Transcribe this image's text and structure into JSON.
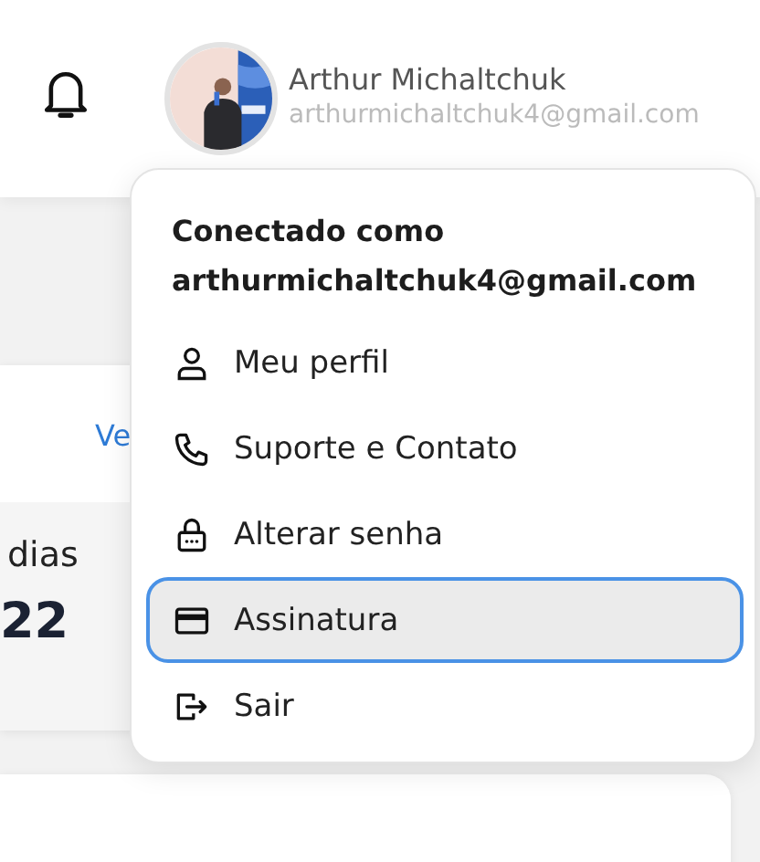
{
  "header": {
    "user": {
      "name": "Arthur Michaltchuk",
      "email": "arthurmichaltchuk4@gmail.com"
    }
  },
  "background_card": {
    "link": "Ve",
    "label": "dias",
    "value": "22"
  },
  "menu": {
    "title": "Conectado como",
    "email": "arthurmichaltchuk4@gmail.com",
    "items": [
      {
        "label": "Meu perfil",
        "kind": "profile",
        "selected": false
      },
      {
        "label": "Suporte e Contato",
        "kind": "phone",
        "selected": false
      },
      {
        "label": "Alterar senha",
        "kind": "lock",
        "selected": false
      },
      {
        "label": "Assinatura",
        "kind": "card",
        "selected": true
      },
      {
        "label": "Sair",
        "kind": "logout",
        "selected": false
      }
    ]
  }
}
